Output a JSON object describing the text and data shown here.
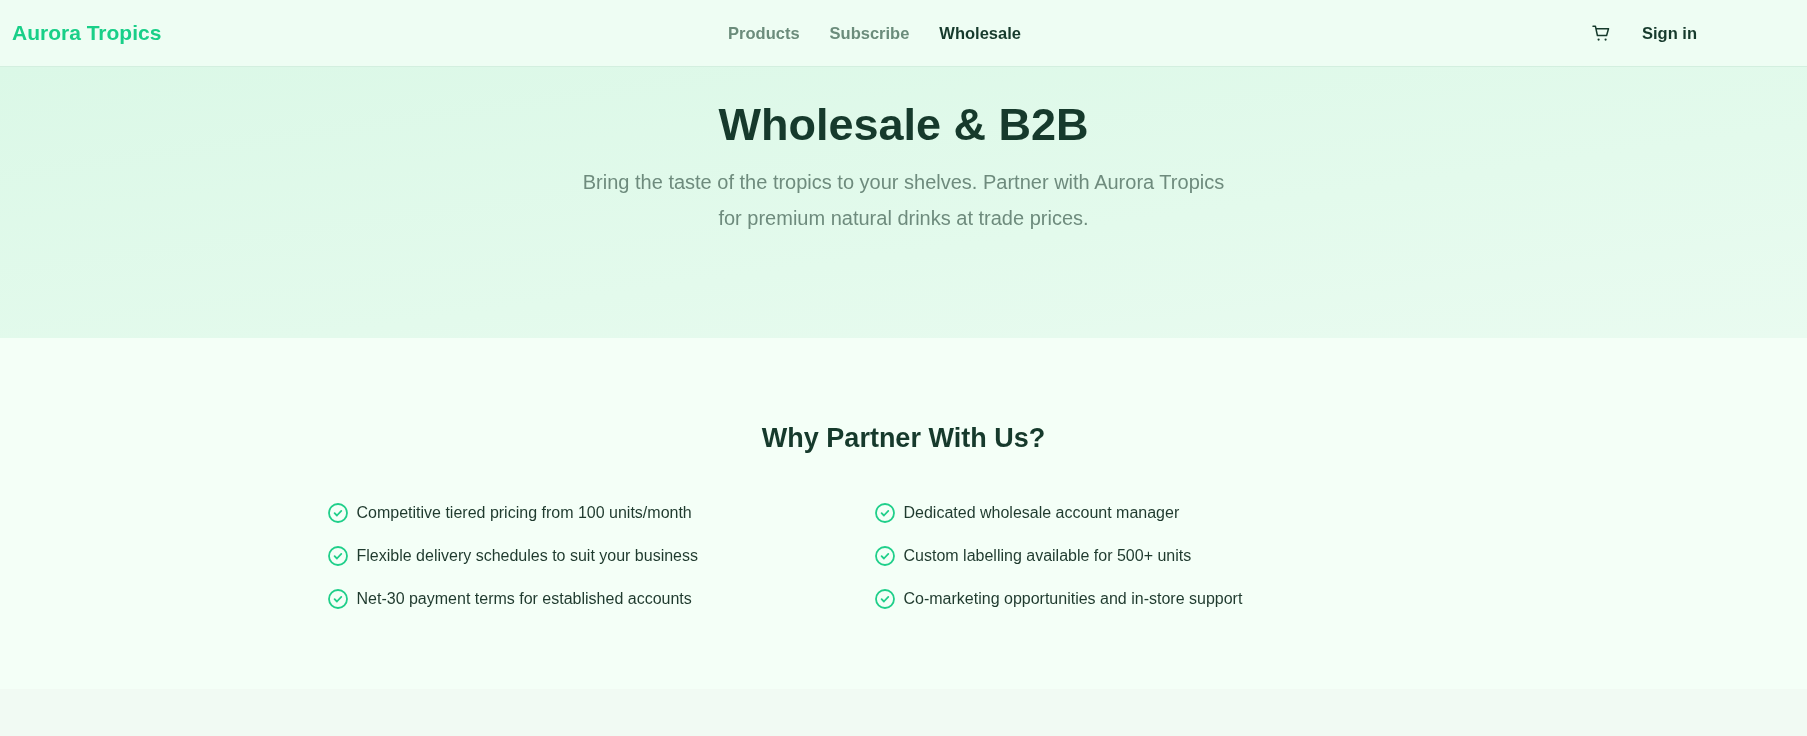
{
  "navbar": {
    "brand": "Aurora Tropics",
    "links": [
      {
        "label": "Products",
        "selected": false
      },
      {
        "label": "Subscribe",
        "selected": false
      },
      {
        "label": "Wholesale",
        "selected": true
      }
    ],
    "sign_in": "Sign in"
  },
  "hero": {
    "title": "Wholesale & B2B",
    "subtitle": "Bring the taste of the tropics to your shelves. Partner with Aurora Tropics for premium natural drinks at trade prices."
  },
  "benefits": {
    "title": "Why Partner With Us?",
    "items": [
      "Competitive tiered pricing from 100 units/month",
      "Dedicated wholesale account manager",
      "Flexible delivery schedules to suit your business",
      "Custom labelling available for 500+ units",
      "Net-30 payment terms for established accounts",
      "Co-marketing opportunities and in-store support"
    ]
  }
}
